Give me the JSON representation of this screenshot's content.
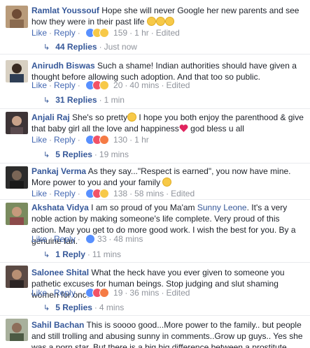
{
  "actions": {
    "like": "Like",
    "reply": "Reply",
    "edited": "Edited",
    "sep": "·"
  },
  "comments": [
    {
      "author": "Ramlat Youssouf",
      "text": "Hope she will never Google her new parents and see how they were in their past life",
      "reactions": [
        "like",
        "haha",
        "wow"
      ],
      "count": "159",
      "time": "1 hr",
      "edited": true,
      "replies_label": "44 Replies",
      "replies_time": "Just now"
    },
    {
      "author": "Anirudh Biswas",
      "text": "Such a shame! Indian authorities should have given a thought before allowing such adoption. And that too so public.",
      "reactions": [
        "like",
        "love",
        "haha"
      ],
      "count": "20",
      "time": "40 mins",
      "edited": true,
      "replies_label": "31 Replies",
      "replies_time": "1 min"
    },
    {
      "author": "Anjali Raj",
      "text_a": "She's so pretty",
      "text_b": " I hope you both enjoy the parenthood & give that baby girl all the love and happiness",
      "text_c": " god bless u all",
      "reactions": [
        "like",
        "love",
        "angry"
      ],
      "count": "130",
      "time": "1 hr",
      "edited": false,
      "replies_label": "5 Replies",
      "replies_time": "19 mins"
    },
    {
      "author": "Pankaj Verma",
      "text": "As they say...\"Respect is earned\", you now have mine. More power to you and your family",
      "reactions": [
        "like",
        "love",
        "haha"
      ],
      "count": "138",
      "time": "58 mins",
      "edited": true,
      "replies_label": "",
      "replies_time": ""
    },
    {
      "author": "Akshata Vidya",
      "text_a": "I am so proud of you Ma'am ",
      "mention": "Sunny Leone",
      "text_b": ". It's a very noble action by making someone's life complete. Very proud of this action. May you get to do more good work. I wish the best for you. By a genuine fan.",
      "reactions": [
        "like"
      ],
      "count": "33",
      "time": "48 mins",
      "edited": false,
      "replies_label": "1 Reply",
      "replies_time": "11 mins"
    },
    {
      "author": "Salonee Shital",
      "text": "What the heck have you ever given to someone you pathetic excuses for human beings. Stop judging and slut shaming women for once",
      "reactions": [
        "like",
        "love",
        "angry"
      ],
      "count": "19",
      "time": "36 mins",
      "edited": true,
      "replies_label": "5 Replies",
      "replies_time": "4 mins"
    },
    {
      "author": "Sahil Bachan",
      "text": "This is soooo good...More power to the family.. but people and still trolling and abusing sunny in comments..Grow up guys.. Yes she was a porn star..But there is a big big difference between a prostitute"
    }
  ],
  "colors": {
    "link": "#365899",
    "action": "#4267b2",
    "meta": "#90949c"
  }
}
